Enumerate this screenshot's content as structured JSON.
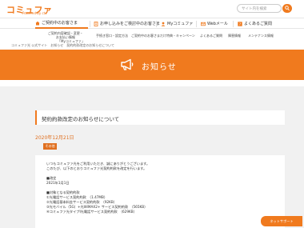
{
  "header": {
    "logo": "コミュファ",
    "logo_sub": "Powered by ctc",
    "search_placeholder": "サイト内を検索"
  },
  "gnav": {
    "items": [
      {
        "label": "ご契約中のお客さま"
      },
      {
        "label": "お申し込みをご検討中のお客さま"
      },
      {
        "label": "Myコミュファ"
      },
      {
        "label": "Webメール"
      },
      {
        "label": "よくあるご質問"
      }
    ]
  },
  "subnav": {
    "items": [
      {
        "line1": "ご契約内容確認・変更・",
        "line2": "お支払い情報",
        "line3": "「Myコミュファ」"
      },
      {
        "line1": "手続き窓口・設定方法",
        "line2": "",
        "line3": ""
      },
      {
        "line1": "ご契約中のお客さまだけ特典・キャンペーン",
        "line2": "",
        "line3": ""
      },
      {
        "line1": "よくあるご質問",
        "line2": "",
        "line3": ""
      },
      {
        "line1": "障害情報",
        "line2": "",
        "line3": ""
      },
      {
        "line1": "メンテナンス情報",
        "line2": "",
        "line3": ""
      }
    ]
  },
  "breadcrumb": "コミュファ光 公式サイト　お知らせ　契約約款改定のお知らせについて",
  "banner": {
    "title": "お知らせ"
  },
  "article": {
    "title": "契約約款改定のお知らせについて",
    "date": "2020年12月21日",
    "badge": "その他",
    "lines": [
      "いつもコミュファ光をご利用いただき、誠にありがとうございます。",
      "このたび、以下のとおりコミュファ光契約約款を改定を行います。",
      "",
      "■改定",
      "2021年1月1日",
      "",
      "■対象となる契約約款",
      "①光電話サービス契約約款　（1.47MB）",
      "②光電話基本料金サービス契約約款　（92KB）",
      "③光モバイル（5G）+光WiMAX2+ サービス契約約款　（565KB）",
      "④コミュファ光タイプⅠ光電話サービス契約約款　（629KB）"
    ]
  },
  "support": {
    "label": "ネットサポート"
  },
  "colors": {
    "accent": "#f07a1e",
    "date": "#e07020",
    "panel_bg": "#f1f1f1"
  }
}
